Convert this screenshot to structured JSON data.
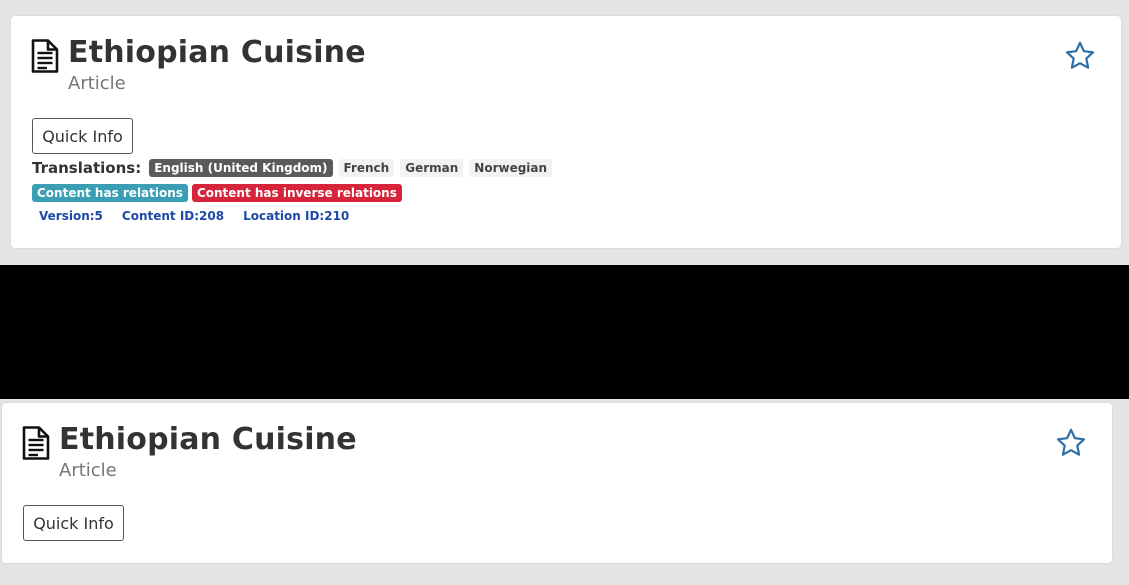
{
  "cards": [
    {
      "title": "Ethiopian Cuisine",
      "content_type": "Article",
      "quick_info_label": "Quick Info",
      "translations_label": "Translations:",
      "translations": [
        "English (United Kingdom)",
        "French",
        "German",
        "Norwegian"
      ],
      "active_translation": "English (United Kingdom)",
      "relations": [
        "Content has relations",
        "Content has inverse relations"
      ],
      "meta": [
        "Version:5",
        "Content ID:208",
        "Location ID:210"
      ]
    },
    {
      "title": "Ethiopian Cuisine",
      "content_type": "Article",
      "quick_info_label": "Quick Info"
    }
  ],
  "icons": {
    "content_type": "document-icon",
    "favorite": "star-outline-icon"
  },
  "colors": {
    "relations_badge": "#3a9eb5",
    "inverse_relations_badge": "#d6243a",
    "meta_text": "#1d4aa8",
    "active_translation_badge": "#5a5a5a",
    "star_outline": "#2d6fa6"
  }
}
